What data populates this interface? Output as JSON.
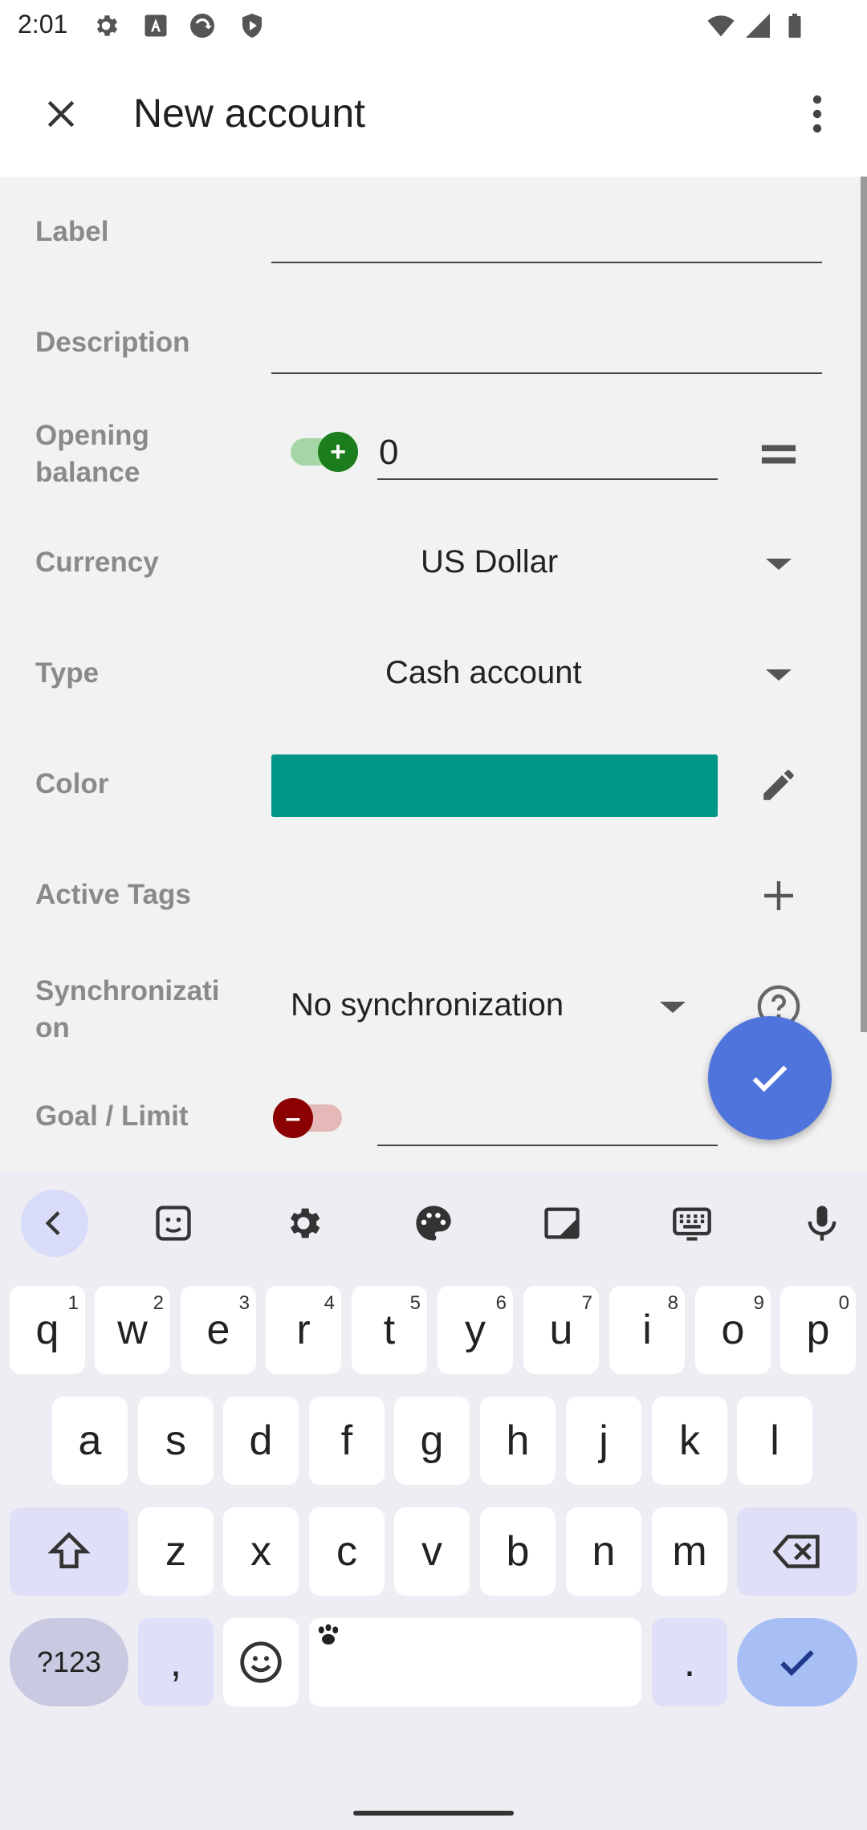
{
  "status_bar": {
    "time": "2:01"
  },
  "app_bar": {
    "title": "New account"
  },
  "form": {
    "label": {
      "label": "Label",
      "value": ""
    },
    "description": {
      "label": "Description",
      "value": ""
    },
    "opening_balance": {
      "label_line1": "Opening",
      "label_line2": "balance",
      "value": "0",
      "sign": "+"
    },
    "currency": {
      "label": "Currency",
      "value": "US Dollar"
    },
    "type": {
      "label": "Type",
      "value": "Cash account"
    },
    "color": {
      "label": "Color",
      "swatch": "#009688"
    },
    "active_tags": {
      "label": "Active Tags"
    },
    "synchronization": {
      "label_line1": "Synchronizati",
      "label_line2": "on",
      "value": "No synchronization"
    },
    "goal_limit": {
      "label": "Goal / Limit",
      "value": "",
      "sign": "–"
    }
  },
  "keyboard": {
    "row1": [
      {
        "k": "q",
        "h": "1"
      },
      {
        "k": "w",
        "h": "2"
      },
      {
        "k": "e",
        "h": "3"
      },
      {
        "k": "r",
        "h": "4"
      },
      {
        "k": "t",
        "h": "5"
      },
      {
        "k": "y",
        "h": "6"
      },
      {
        "k": "u",
        "h": "7"
      },
      {
        "k": "i",
        "h": "8"
      },
      {
        "k": "o",
        "h": "9"
      },
      {
        "k": "p",
        "h": "0"
      }
    ],
    "row2": [
      "a",
      "s",
      "d",
      "f",
      "g",
      "h",
      "j",
      "k",
      "l"
    ],
    "row3": [
      "z",
      "x",
      "c",
      "v",
      "b",
      "n",
      "m"
    ],
    "symbols_label": "?123",
    "comma": ",",
    "period": "."
  },
  "colors": {
    "accent": "#4f74dc",
    "toggle_on": "#1b7d1b",
    "toggle_off": "#8b0000"
  }
}
